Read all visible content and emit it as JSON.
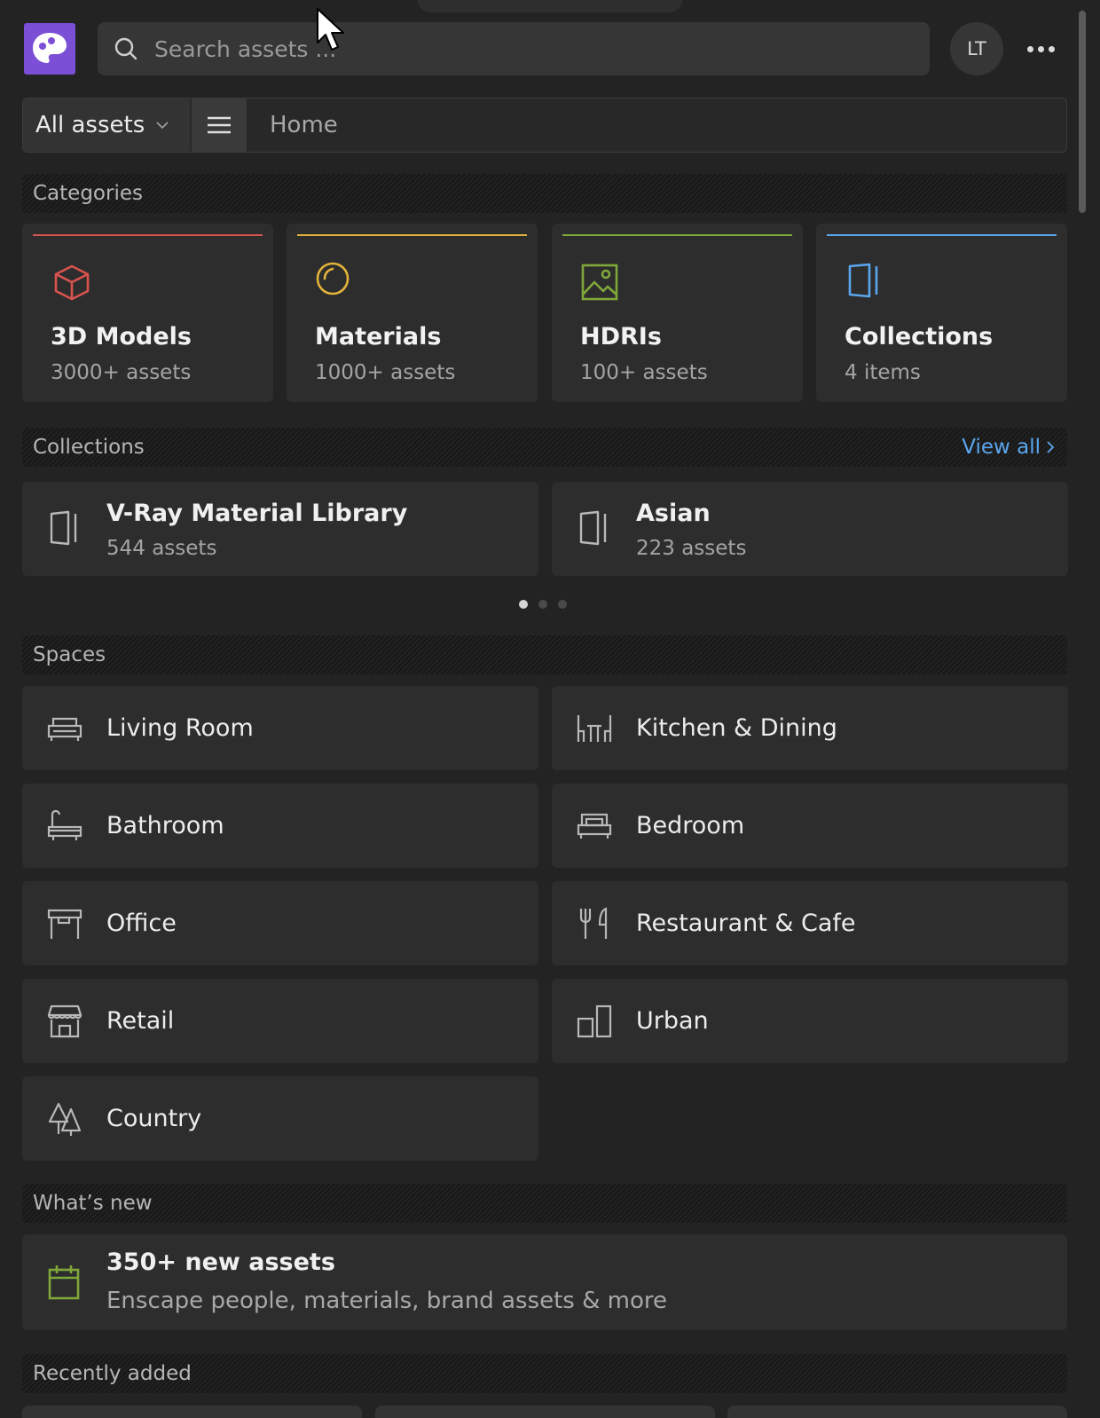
{
  "header": {
    "search_placeholder": "Search assets ...",
    "avatar_initials": "LT",
    "logo_color": "#7b4fd6"
  },
  "navbar": {
    "filter_selected": "All assets",
    "breadcrumb": "Home"
  },
  "sections": {
    "categories": "Categories",
    "collections": "Collections",
    "collections_view_all": "View all",
    "spaces": "Spaces",
    "whats_new": "What’s new",
    "recently_added": "Recently added"
  },
  "categories": [
    {
      "title": "3D Models",
      "subtitle": "3000+ assets",
      "accent": "#d9534f",
      "icon": "cube-icon"
    },
    {
      "title": "Materials",
      "subtitle": "1000+ assets",
      "accent": "#e2b33a",
      "icon": "material-sphere-icon"
    },
    {
      "title": "HDRIs",
      "subtitle": "100+ assets",
      "accent": "#7fa83a",
      "icon": "image-icon"
    },
    {
      "title": "Collections",
      "subtitle": "4 items",
      "accent": "#5aa6ee",
      "icon": "collection-icon"
    }
  ],
  "collections": [
    {
      "title": "V-Ray Material Library",
      "subtitle": "544 assets"
    },
    {
      "title": "Asian",
      "subtitle": "223 assets"
    }
  ],
  "carousel": {
    "pages": 3,
    "active": 1
  },
  "spaces": [
    {
      "label": "Living Room",
      "icon": "sofa-icon"
    },
    {
      "label": "Kitchen & Dining",
      "icon": "dining-table-icon"
    },
    {
      "label": "Bathroom",
      "icon": "bathtub-icon"
    },
    {
      "label": "Bedroom",
      "icon": "bed-icon"
    },
    {
      "label": "Office",
      "icon": "desk-icon"
    },
    {
      "label": "Restaurant & Cafe",
      "icon": "fork-knife-icon"
    },
    {
      "label": "Retail",
      "icon": "storefront-icon"
    },
    {
      "label": "Urban",
      "icon": "buildings-icon"
    },
    {
      "label": "Country",
      "icon": "trees-icon"
    }
  ],
  "whats_new": {
    "title": "350+ new assets",
    "subtitle": "Enscape people, materials, brand assets & more",
    "accent": "#7fa83a"
  }
}
